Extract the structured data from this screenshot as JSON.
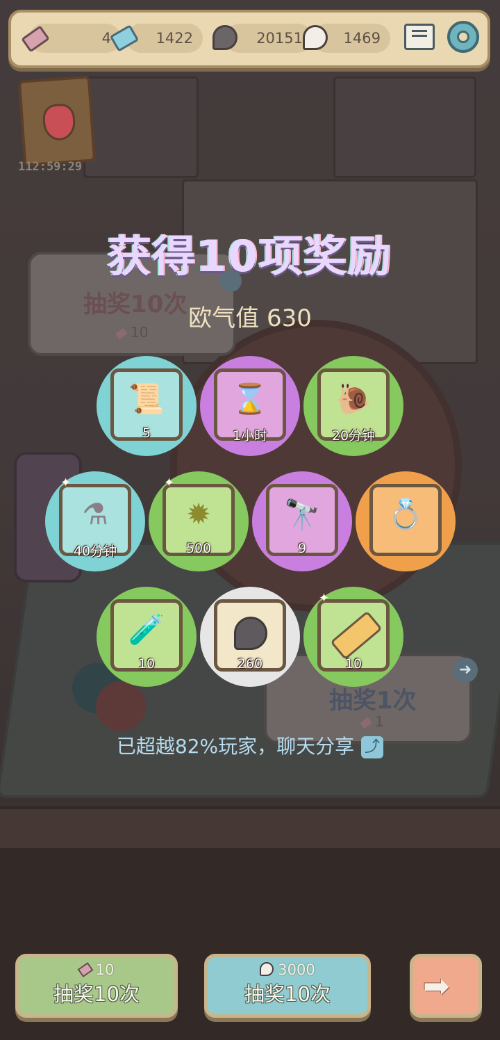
{
  "currencies": {
    "tickets": "4",
    "gems": "1422",
    "dark_bubbles": "20151",
    "light_bubbles": "1469"
  },
  "event_timer": "112:59:29",
  "background": {
    "panel_left_title": "抽奖10次",
    "panel_left_cost": "10",
    "panel_right_title": "抽奖1次",
    "panel_right_cost": "1"
  },
  "reward_title": "获得10项奖励",
  "luck": "欧气值 630",
  "rewards": [
    {
      "name": "scroll",
      "count": "5"
    },
    {
      "name": "hourglass",
      "count": "1小时"
    },
    {
      "name": "snail",
      "count": "20分钟"
    },
    {
      "name": "molecule",
      "count": "40分钟"
    },
    {
      "name": "spiky-shell",
      "count": "500"
    },
    {
      "name": "telescope",
      "count": "9"
    },
    {
      "name": "ring",
      "count": ""
    },
    {
      "name": "potion-bottle",
      "count": "10"
    },
    {
      "name": "dark-bubble",
      "count": "260"
    },
    {
      "name": "tube",
      "count": "10"
    }
  ],
  "share_text": "已超越82%玩家，聊天分享",
  "buttons": {
    "draw_ticket_cost": "10",
    "draw_ticket_label": "抽奖10次",
    "draw_bubble_cost": "3000",
    "draw_bubble_label": "抽奖10次"
  },
  "colors": {
    "orb_cyan": "#7fd3d4",
    "orb_purple": "#c97fe0",
    "orb_green": "#86c95f",
    "orb_orange": "#f0a04a",
    "orb_white": "#e6e6e6"
  }
}
